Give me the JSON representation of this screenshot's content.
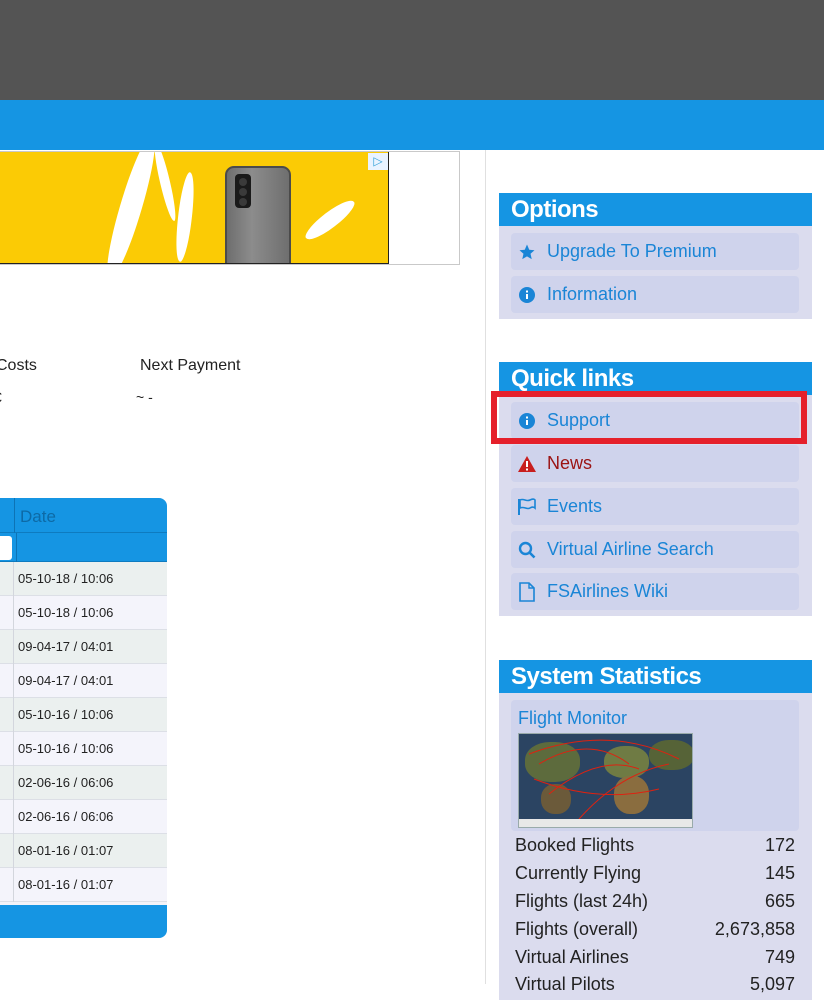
{
  "ad": {
    "choice_icon": "play-triangle-icon"
  },
  "costs": {
    "col1_header": "Costs",
    "col2_header": "Next Payment",
    "col1_value": "€",
    "col2_value": "~ -"
  },
  "table": {
    "date_header": "Date",
    "rows": [
      "05-10-18 / 10:06",
      "05-10-18 / 10:06",
      "09-04-17 / 04:01",
      "09-04-17 / 04:01",
      "05-10-16 / 10:06",
      "05-10-16 / 10:06",
      "02-06-16 / 06:06",
      "02-06-16 / 06:06",
      "08-01-16 / 01:07",
      "08-01-16 / 01:07"
    ]
  },
  "options": {
    "title": "Options",
    "items": [
      {
        "label": "Upgrade To Premium",
        "icon": "star-icon"
      },
      {
        "label": "Information",
        "icon": "info-icon"
      }
    ]
  },
  "quick_links": {
    "title": "Quick links",
    "items": [
      {
        "label": "Support",
        "icon": "info-icon"
      },
      {
        "label": "News",
        "icon": "warning-icon"
      },
      {
        "label": "Events",
        "icon": "flag-icon"
      },
      {
        "label": "Virtual Airline Search",
        "icon": "search-icon"
      },
      {
        "label": "FSAirlines Wiki",
        "icon": "document-icon"
      }
    ]
  },
  "system_statistics": {
    "title": "System Statistics",
    "flight_monitor": "Flight Monitor",
    "stats": [
      {
        "label": "Booked Flights",
        "value": "172"
      },
      {
        "label": "Currently Flying",
        "value": "145"
      },
      {
        "label": "Flights (last 24h)",
        "value": "665"
      },
      {
        "label": "Flights (overall)",
        "value": "2,673,858"
      },
      {
        "label": "Virtual Airlines",
        "value": "749"
      },
      {
        "label": "Virtual Pilots",
        "value": "5,097"
      }
    ]
  },
  "colors": {
    "accent": "#1595e3",
    "highlight": "#e5202b",
    "panel_bg": "#dbdcee"
  }
}
